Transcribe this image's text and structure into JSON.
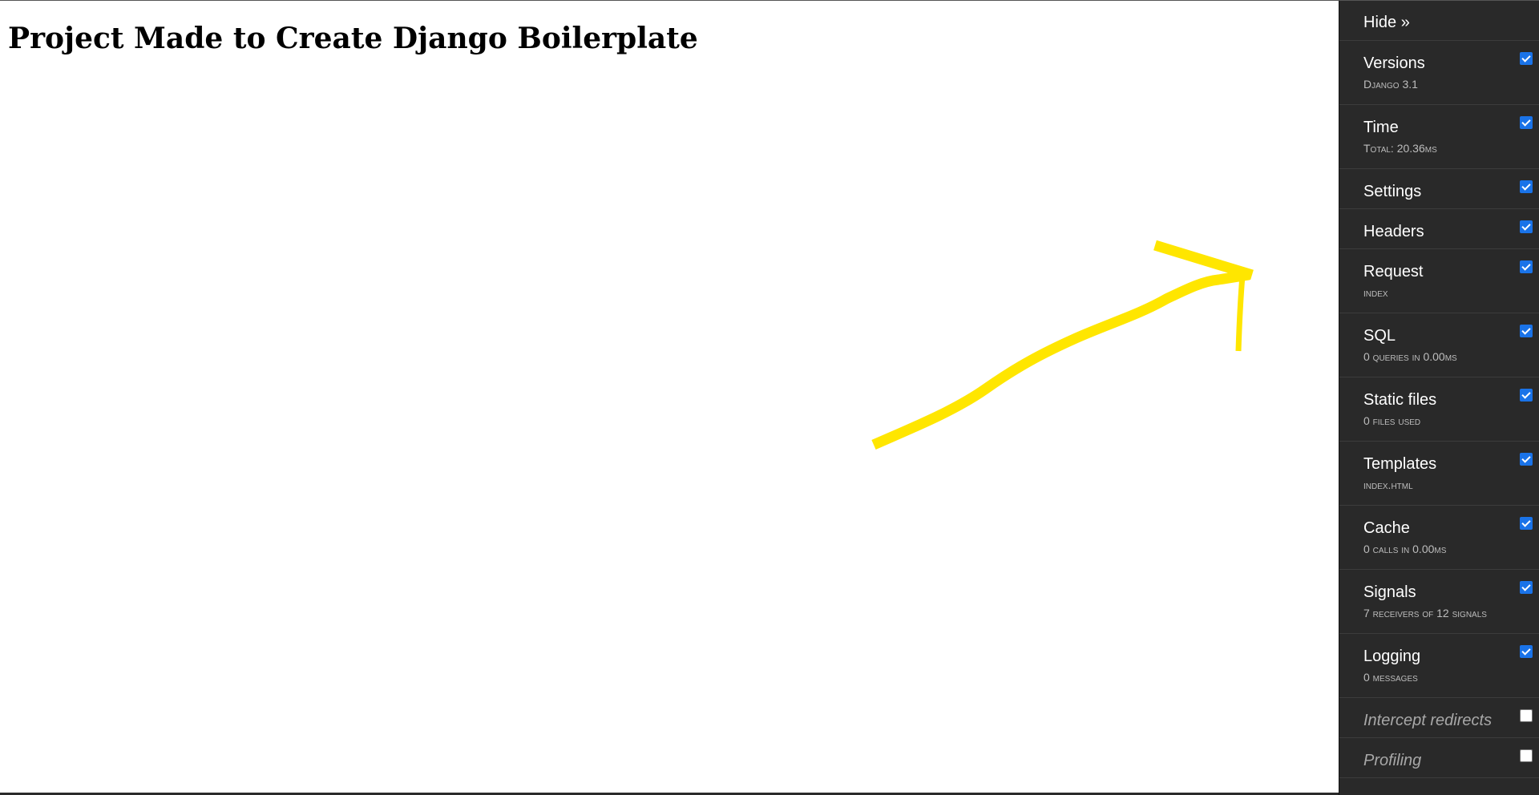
{
  "page": {
    "heading": "Project Made to Create Django Boilerplate"
  },
  "annotation": {
    "type": "hand-drawn arrow",
    "color": "#ffe600"
  },
  "toolbar": {
    "hide_label": "Hide »",
    "panels": [
      {
        "title": "Versions",
        "subtitle": "Django 3.1",
        "checked": true
      },
      {
        "title": "Time",
        "subtitle": "Total: 20.36ms",
        "checked": true
      },
      {
        "title": "Settings",
        "subtitle": "",
        "checked": true
      },
      {
        "title": "Headers",
        "subtitle": "",
        "checked": true
      },
      {
        "title": "Request",
        "subtitle": "index",
        "checked": true
      },
      {
        "title": "SQL",
        "subtitle": "0 queries in 0.00ms",
        "checked": true
      },
      {
        "title": "Static files",
        "subtitle": "0 files used",
        "checked": true
      },
      {
        "title": "Templates",
        "subtitle": "index.html",
        "checked": true
      },
      {
        "title": "Cache",
        "subtitle": "0 calls in 0.00ms",
        "checked": true
      },
      {
        "title": "Signals",
        "subtitle": "7 receivers of 12 signals",
        "checked": true
      },
      {
        "title": "Logging",
        "subtitle": "0 messages",
        "checked": true
      },
      {
        "title": "Intercept redirects",
        "subtitle": "",
        "checked": false
      },
      {
        "title": "Profiling",
        "subtitle": "",
        "checked": false
      }
    ],
    "colors": {
      "background": "#292929",
      "checkbox_accent": "#1a73e8",
      "subtitle": "#bdbdbd"
    }
  }
}
